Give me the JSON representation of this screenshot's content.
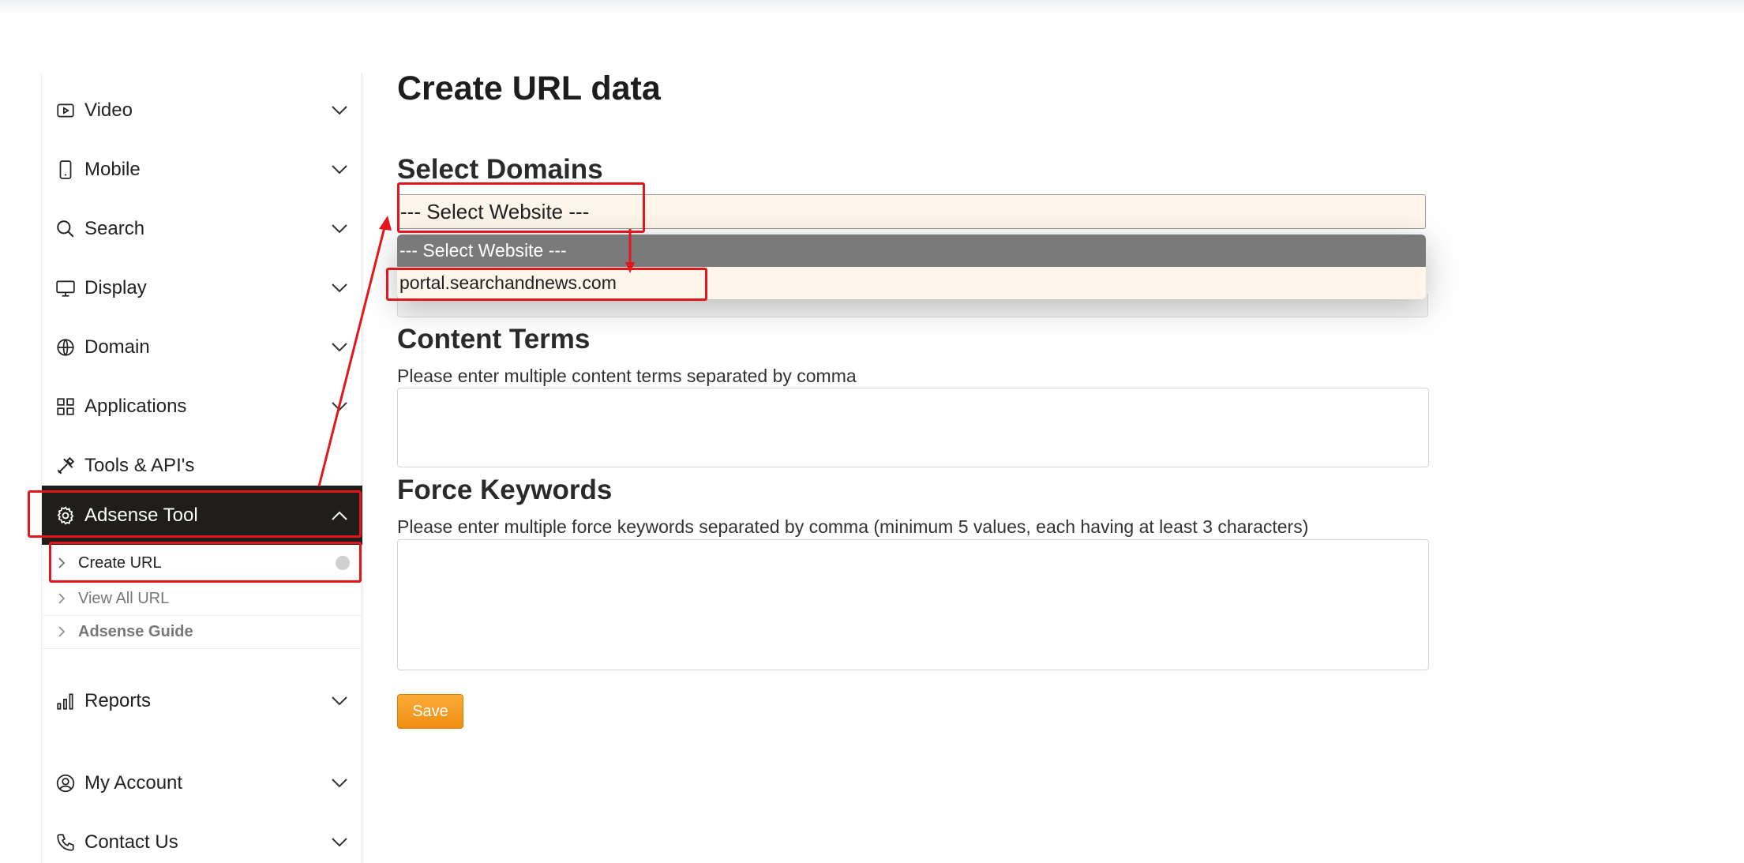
{
  "sidebar": {
    "items": [
      {
        "label": "Video"
      },
      {
        "label": "Mobile"
      },
      {
        "label": "Search"
      },
      {
        "label": "Display"
      },
      {
        "label": "Domain"
      },
      {
        "label": "Applications"
      },
      {
        "label": "Tools & API's"
      },
      {
        "label": "Adsense Tool"
      },
      {
        "label": "Reports"
      },
      {
        "label": "My Account"
      },
      {
        "label": "Contact Us"
      }
    ],
    "subitems": [
      {
        "label": "Create URL"
      },
      {
        "label": "View All URL"
      },
      {
        "label": "Adsense Guide"
      }
    ]
  },
  "main": {
    "title": "Create URL data",
    "domains": {
      "heading": "Select Domains",
      "selected": "--- Select Website ---",
      "options": [
        "--- Select Website ---",
        "portal.searchandnews.com"
      ]
    },
    "content_terms": {
      "heading": "Content Terms",
      "hint": "Please enter multiple content terms separated by comma"
    },
    "force_keywords": {
      "heading": "Force Keywords",
      "hint": "Please enter multiple force keywords separated by comma (minimum 5 values, each having at least 3 characters)"
    },
    "save_label": "Save"
  },
  "colors": {
    "active_nav": "#201e1a",
    "select_bg": "#fff5eb",
    "highlight_option": "#7a7a7a",
    "save_button": "#f7a02a",
    "annotation": "#e3161b"
  }
}
